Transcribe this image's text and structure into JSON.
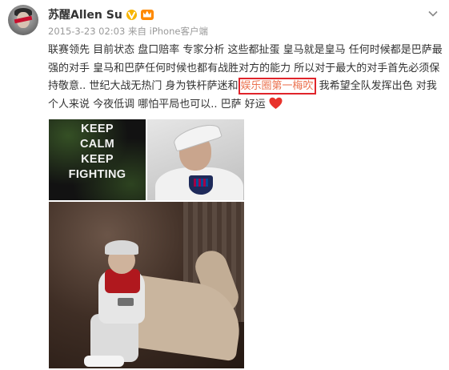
{
  "post": {
    "author": "苏醒Allen Su",
    "meta": "2015-3-23 02:03 来自 iPhone客户端",
    "text_before": "联赛领先 目前状态 盘口赔率 专家分析 这些都扯蛋 皇马就是皇马 任何时候都是巴萨最强的对手 皇马和巴萨任何时候也都有战胜对方的能力 所以对于最大的对手首先必须保持敬意.. 世纪大战无热门 身为铁杆萨迷和",
    "text_highlight": "娱乐圈第一梅吹",
    "text_after": " 我希望全队发挥出色 对我个人来说 今夜低调 哪怕平局也可以.. 巴萨 好运",
    "photo1_lines": [
      "KEEP",
      "CALM",
      "KEEP",
      "FIGHTING"
    ]
  },
  "icons": {
    "avatar": "avatar",
    "verified": "verified-badge-icon",
    "member": "member-crown-icon",
    "menu": "chevron-down-icon",
    "heart": "heart-emoji-icon"
  },
  "colors": {
    "link": "#eb7350",
    "highlight_border": "#e0242b",
    "meta": "#999999"
  }
}
